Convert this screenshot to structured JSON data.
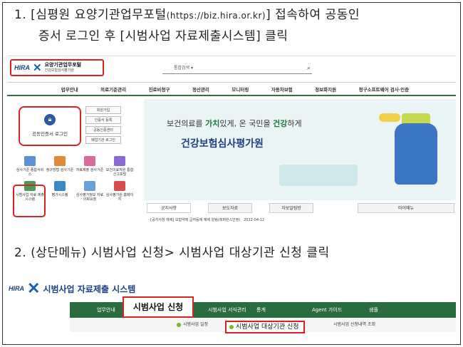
{
  "instructions": {
    "step1_line1": "1. [심평원  요양기관업무포털",
    "step1_url": "(https://biz.hira.or.kr)",
    "step1_line1_tail": "]  접속하여  공동인",
    "step1_line2": "증서 로그인 후 [시범사업 자료제출시스템] 클릭",
    "step2": "2. (상단메뉴) 시범사업 신청> 시범사업 대상기관 신청 클릭"
  },
  "portal": {
    "brand": "HIRA",
    "logo_title": "요양기관업무포털",
    "logo_sub": "건강보험심사평가원",
    "search_placeholder": "통합검색 ▾",
    "nav": [
      "업무안내",
      "의료기준관리",
      "진료비청구",
      "정산관리",
      "모니터링",
      "자동차보험",
      "정보화지원",
      "청구소프트웨어 검사·인증"
    ],
    "login_label": "공동인증서 로그인",
    "mini_buttons": [
      "회원가입",
      "인증서 등록",
      "공동인증센터",
      "폐업기관 로그인"
    ],
    "icons": [
      "심사기준 종합서비스",
      "청구방법 검사기준",
      "자료제출 검사기준",
      "보건의료자원 통합신고포털",
      "시범사업 자료 제출 시스템",
      "평가시스템",
      "심사평가정보 자료의뢰요청",
      "심사평가원 홈페이지"
    ],
    "banner_text_pre": "보건의료를 ",
    "banner_text_bold1": "가치",
    "banner_text_mid": "있게, 온 국민을 ",
    "banner_text_bold2": "건강",
    "banner_text_post": "하게",
    "banner_org": "건강보험심사평가원",
    "tabs": [
      "공지사항",
      "보도자료",
      "자보알림방",
      "마이메뉴"
    ],
    "news_item": "· [공지사항 예제] 보험약제 급여등재 예제 알림(레퍼런스안정)",
    "news_date": "2022-04-12"
  },
  "system": {
    "brand": "HIRA",
    "title": "시범사업 자료제출 시스템",
    "nav": [
      "업무안내",
      "시범사업 신청",
      "시범사업 서식관리",
      "통계",
      "Agent 가이드",
      "샘플"
    ],
    "sub": [
      "시범사업 일정",
      "시범사업 대상기관 신청",
      "시범사업 신청내역 조회"
    ]
  },
  "colors": {
    "highlight": "#e02020",
    "nav_green": "#2b6c3f",
    "brand_blue": "#1d3f8a"
  }
}
